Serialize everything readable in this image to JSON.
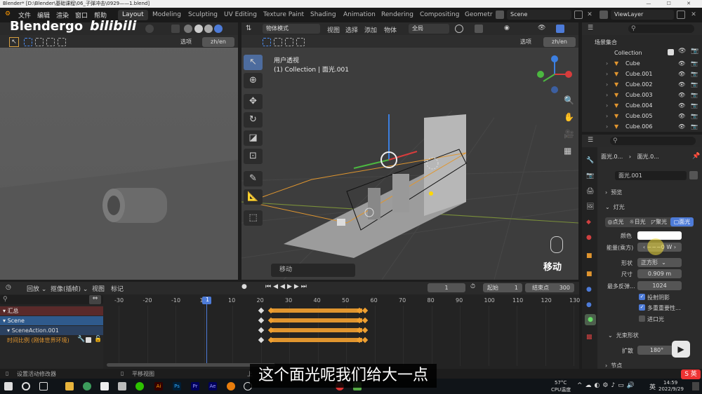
{
  "window": {
    "title": "Blender* [D:\\Blender\\基础课程\\06_子弹冲击\\0929——1.blend]"
  },
  "menubar": {
    "menus": [
      "文件",
      "编辑",
      "渲染",
      "窗口",
      "帮助"
    ],
    "workspaces": [
      "Layout",
      "Modeling",
      "Sculpting",
      "UV Editing",
      "Texture Paint",
      "Shading",
      "Animation",
      "Rendering",
      "Compositing",
      "Geometr"
    ],
    "scene": "Scene",
    "viewlayer": "ViewLayer"
  },
  "overlay_brand": {
    "text": "Blendergo",
    "site": "bilibili"
  },
  "left_view": {
    "options": "选项",
    "lang": "zh/en"
  },
  "right_view": {
    "mode": "物体模式",
    "menus": [
      "视图",
      "选择",
      "添加",
      "物体"
    ],
    "transform": "全局",
    "options": "选项",
    "lang": "zh/en",
    "view_name": "用户透视",
    "collection_info": "(1) Collection | 面光.001",
    "operator_panel": "移动",
    "key_hint": "移动"
  },
  "outliner": {
    "root": "场景集合",
    "collection": "Collection",
    "items": [
      "Cube",
      "Cube.001",
      "Cube.002",
      "Cube.003",
      "Cube.004",
      "Cube.005",
      "Cube.006"
    ]
  },
  "properties": {
    "crumb_object": "面光.0...",
    "crumb_data": "面光.0...",
    "data_name": "面光.001",
    "section_preview": "预览",
    "section_light": "灯光",
    "light_types": [
      "点光",
      "日光",
      "聚光",
      "面光"
    ],
    "active_type": "面光",
    "color_label": "颜色",
    "color_value": "#ffffff",
    "power_label": "能量(乘方)",
    "power_value": "~~~0 W",
    "shape_label": "形状",
    "shape_value": "正方形",
    "size_label": "尺寸",
    "size_value": "0.909 m",
    "max_bounces_label": "最多反弹...",
    "max_bounces_value": "1024",
    "cast_shadow": "投射阴影",
    "multi_importance": "多重重要性...",
    "contact_shadow": "进口光",
    "section_beam": "光束形状",
    "spread_label": "扩散",
    "spread_value": "180°",
    "section_nodes": "节点"
  },
  "timeline": {
    "playback": "回放",
    "keying": "抠像(插帧)",
    "view": "视图",
    "marker": "标记",
    "current_frame": "1",
    "start_label": "起始",
    "start": "1",
    "end_label": "结束点",
    "end": "300",
    "ticks": [
      "-30",
      "-20",
      "-10",
      "1",
      "10",
      "20",
      "30",
      "40",
      "50",
      "60",
      "70",
      "80",
      "90",
      "100",
      "110",
      "120",
      "130"
    ],
    "channels": [
      "汇总",
      "Scene",
      "SceneAction.001",
      "时间比例 (刚体世界环境)"
    ]
  },
  "statusbar": {
    "left": "设置活动修改器",
    "mid": "平移视图",
    "mid2": "上"
  },
  "taskbar": {
    "temp": "57°C",
    "temp_label": "CPU温度",
    "ime": "英",
    "time": "14:59",
    "date": "2022/9/29"
  },
  "subtitle": {
    "text": "这个面光呢我们给大一点"
  }
}
